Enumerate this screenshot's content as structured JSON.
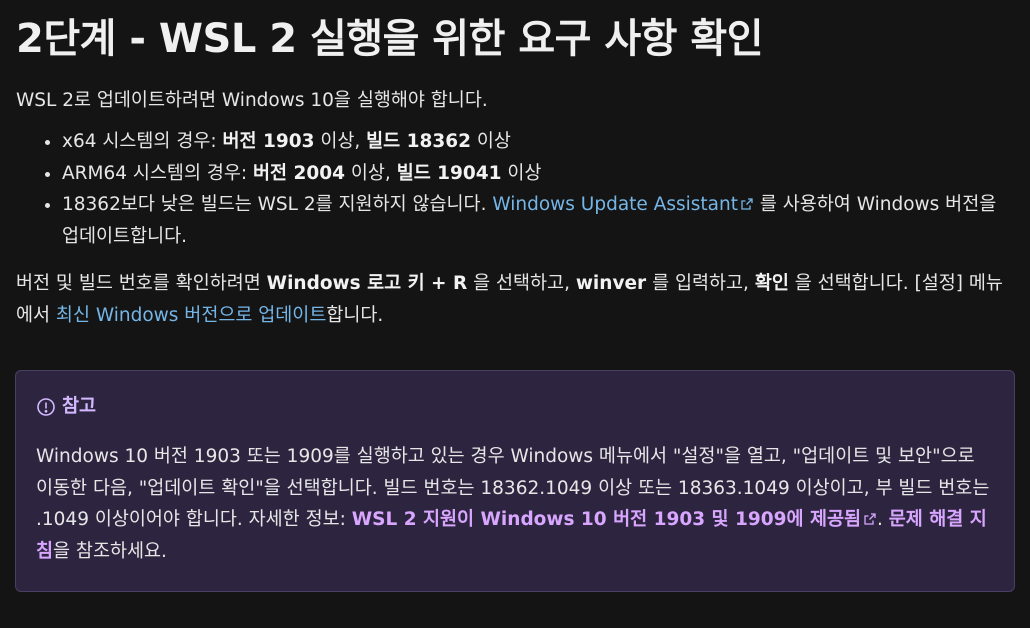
{
  "title": "2단계 - WSL 2 실행을 위한 요구 사항 확인",
  "intro": "WSL 2로 업데이트하려면 Windows 10을 실행해야 합니다.",
  "requirements": [
    {
      "prefix": "x64 시스템의 경우: ",
      "version_label": "버전 1903",
      "mid": " 이상, ",
      "build_label": "빌드 18362",
      "suffix": " 이상"
    },
    {
      "prefix": "ARM64 시스템의 경우: ",
      "version_label": "버전 2004",
      "mid": " 이상, ",
      "build_label": "빌드 19041",
      "suffix": " 이상"
    }
  ],
  "old_build": {
    "prefix": "18362보다 낮은 빌드는 WSL 2를 지원하지 않습니다. ",
    "link": "Windows Update Assistant",
    "suffix": " 를 사용하여 Windows 버전을 업데이트합니다."
  },
  "howto": {
    "t1": "버전 및 빌드 번호를 확인하려면 ",
    "k1": "Windows 로고 키 + R",
    "t2": " 을 선택하고, ",
    "k2": "winver",
    "t3": " 를 입력하고, ",
    "k3": "확인",
    "t4": " 을 선택합니다. [설정] 메뉴에서 ",
    "link": "최신 Windows 버전으로 업데이트",
    "t5": "합니다."
  },
  "note": {
    "heading": "참고",
    "body": "Windows 10 버전 1903 또는 1909를 실행하고 있는 경우 Windows 메뉴에서 \"설정\"을 열고, \"업데이트 및 보안\"으로 이동한 다음, \"업데이트 확인\"을 선택합니다. 빌드 번호는 18362.1049 이상 또는 18363.1049 이상이고, 부 빌드 번호는 .1049 이상이어야 합니다. 자세한 정보: ",
    "link1": "WSL 2 지원이 Windows 10 버전 1903 및 1909에 제공됨",
    "sep": ". ",
    "link2": "문제 해결 지침",
    "tail": "을 참조하세요."
  },
  "colors": {
    "background": "#141414",
    "link": "#75b6e7",
    "note_background": "#2d2540",
    "note_accent": "#d3b8ff"
  },
  "icons": {
    "external": "external-link-icon",
    "note": "info-circle-icon"
  }
}
